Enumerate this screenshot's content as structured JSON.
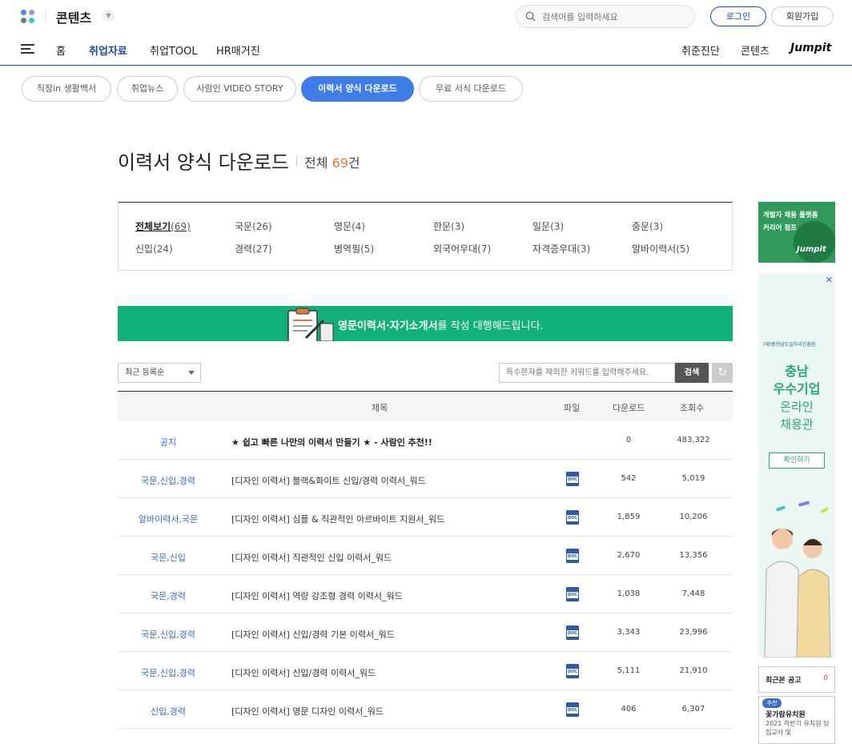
{
  "header": {
    "brand": "콘텐츠",
    "search_placeholder": "검색어를 입력하세요",
    "login": "로그인",
    "join": "회원가입"
  },
  "nav": {
    "left": [
      "홈",
      "취업자료",
      "취업TOOL",
      "HR매거진"
    ],
    "active_index": 1,
    "right": [
      "취준진단",
      "콘텐츠"
    ],
    "jumpit": "Jumpit"
  },
  "subtabs": {
    "items": [
      "직장in 생활백서",
      "취업뉴스",
      "사람인 VIDEO STORY",
      "이력서 양식 다운로드",
      "무료 서식 다운로드"
    ],
    "active_index": 3
  },
  "page": {
    "title": "이력서 양식 다운로드",
    "total_label": "전체",
    "total_count": "69",
    "total_unit": "건"
  },
  "filters": [
    {
      "label": "전체보기",
      "count": "(69)",
      "active": true
    },
    {
      "label": "국문",
      "count": "(26)"
    },
    {
      "label": "영문",
      "count": "(4)"
    },
    {
      "label": "한문",
      "count": "(3)"
    },
    {
      "label": "일문",
      "count": "(3)"
    },
    {
      "label": "중문",
      "count": "(3)"
    },
    {
      "label": "신입",
      "count": "(24)"
    },
    {
      "label": "경력",
      "count": "(27)"
    },
    {
      "label": "병역필",
      "count": "(5)"
    },
    {
      "label": "외국어우대",
      "count": "(7)"
    },
    {
      "label": "자격증우대",
      "count": "(3)"
    },
    {
      "label": "알바이력서",
      "count": "(5)"
    }
  ],
  "banner": {
    "bold": "영문이력서·자기소개서",
    "rest": "를 작성 대행해드립니다."
  },
  "toolbar": {
    "sort": "최근 등록순",
    "keyword_placeholder": "특수문자를 제외한 키워드를 입력해주세요.",
    "search": "검색"
  },
  "table": {
    "headers": [
      "제목",
      "파일",
      "다운로드",
      "조회수"
    ],
    "file_icon": "doc-file-icon",
    "file_icon_text": "DOC",
    "rows": [
      {
        "category": "공지",
        "title": "★ 쉽고 빠른 나만의 이력서 만들기 ★ - 사람인 추천!!",
        "file": false,
        "downloads": "0",
        "views": "483,322",
        "notice": true
      },
      {
        "category": "국문,신입,경력",
        "title": "[디자인 이력서] 블랙&화이트 신입/경력 이력서_워드",
        "file": true,
        "downloads": "542",
        "views": "5,019"
      },
      {
        "category": "알바이력서,국문",
        "title": "[디자인 이력서] 심플 & 직관적인 아르바이트 지원서_워드",
        "file": true,
        "downloads": "1,859",
        "views": "10,206"
      },
      {
        "category": "국문,신입",
        "title": "[디자인 이력서] 직관적인 신입 이력서_워드",
        "file": true,
        "downloads": "2,670",
        "views": "13,356"
      },
      {
        "category": "국문,경력",
        "title": "[디자인 이력서] 역량 강조형 경력 이력서_워드",
        "file": true,
        "downloads": "1,038",
        "views": "7,448"
      },
      {
        "category": "국문,신입,경력",
        "title": "[디자인 이력서] 신입/경력 기본 이력서_워드",
        "file": true,
        "downloads": "3,343",
        "views": "23,996"
      },
      {
        "category": "국문,신입,경력",
        "title": "[디자인 이력서] 신입/경력 이력서_워드",
        "file": true,
        "downloads": "5,111",
        "views": "21,910"
      },
      {
        "category": "신입,경력",
        "title": "[디자인 이력서] 영문 디자인 이력서_워드",
        "file": true,
        "downloads": "406",
        "views": "6,307"
      }
    ]
  },
  "ads": {
    "jumpit_lines": [
      "개발자 채용 플랫폼",
      "커리어 점프"
    ],
    "jumpit_logo": "Jumpit",
    "close": "✕",
    "org": "(재)충청남도일자리진흥원",
    "headline": [
      "충남",
      "우수기업"
    ],
    "sub": [
      "온라인",
      "채용관"
    ],
    "cta": "확인하기"
  },
  "recent": {
    "label": "최근본 공고",
    "count": "0",
    "badge": "추천",
    "name": "꽃가람유치원",
    "desc": "2021 하반기 유치원 담임교사 및"
  },
  "colors": {
    "brand_blue": "#1e4ca0",
    "active_pill": "#3f7ee8",
    "banner_green": "#13b17a",
    "count_orange": "#e8743b",
    "category_blue": "#3a6cc1"
  }
}
